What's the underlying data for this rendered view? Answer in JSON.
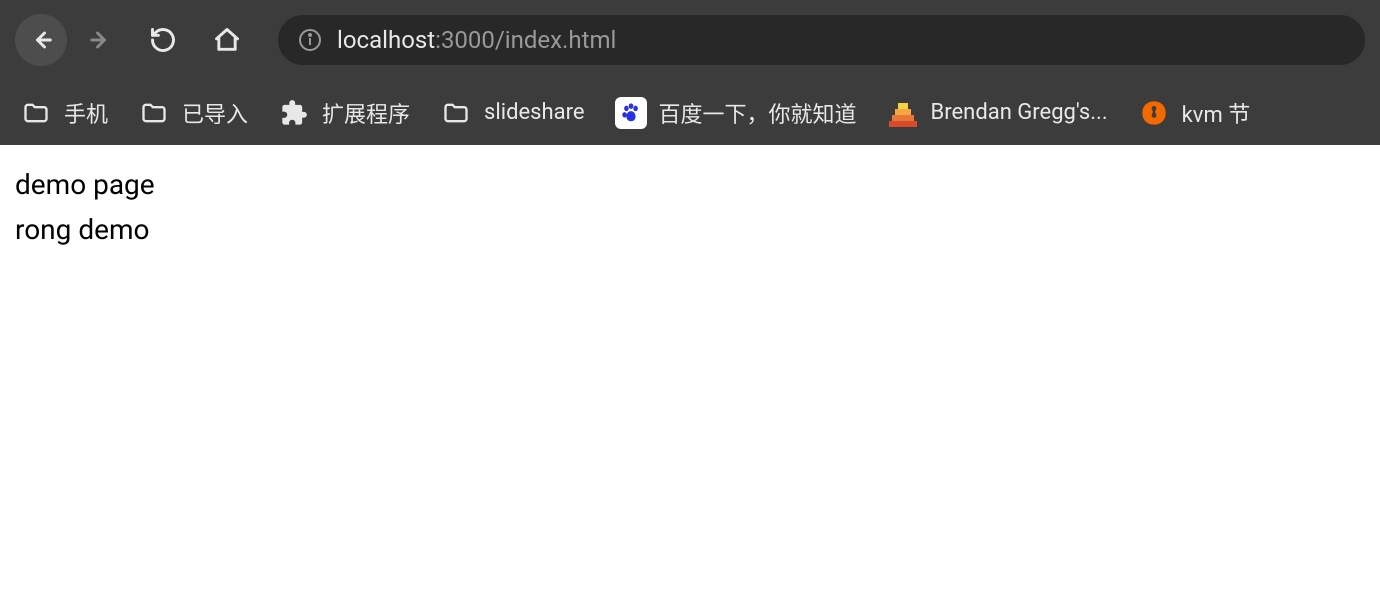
{
  "url": {
    "host": "localhost",
    "path": ":3000/index.html"
  },
  "bookmarks": {
    "b0": {
      "label": "手机"
    },
    "b1": {
      "label": "已导入"
    },
    "b2": {
      "label": "扩展程序"
    },
    "b3": {
      "label": "slideshare"
    },
    "b4": {
      "label": "百度一下，你就知道"
    },
    "b5": {
      "label": "Brendan Gregg's..."
    },
    "b6": {
      "label": "kvm 节"
    }
  },
  "page": {
    "line1": "demo page",
    "line2": "rong demo"
  }
}
